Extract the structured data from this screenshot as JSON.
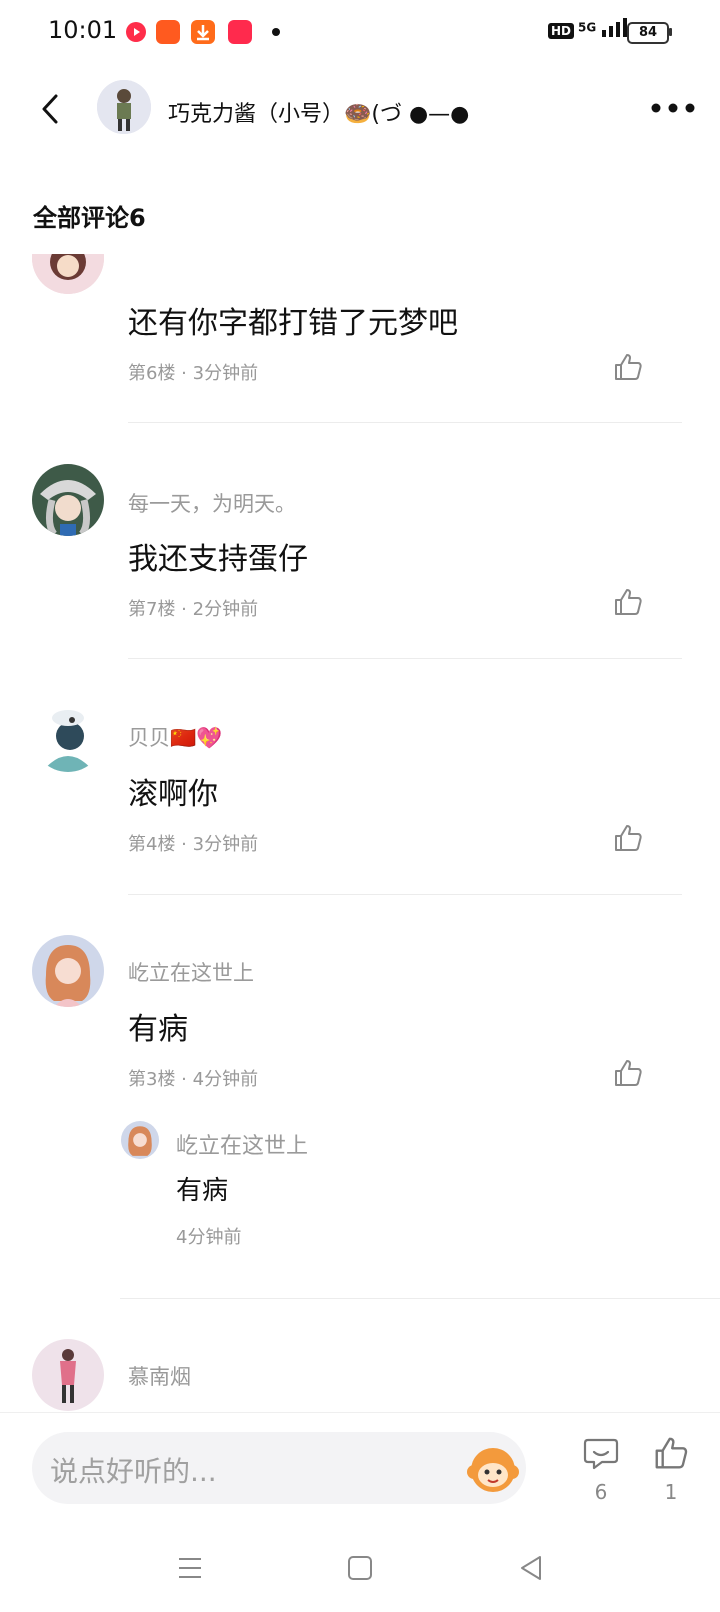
{
  "status_bar": {
    "time": "10:01",
    "network": "HD",
    "signal": "5G",
    "battery": "84"
  },
  "header": {
    "title": "巧克力酱（小号）🍩(づ ●—●"
  },
  "section": {
    "title": "全部评论6"
  },
  "comments": [
    {
      "username": "",
      "text": "还有你字都打错了元梦吧",
      "meta": "第6楼 · 3分钟前"
    },
    {
      "username": "每一天，为明天。",
      "text": "我还支持蛋仔",
      "meta": "第7楼 · 2分钟前"
    },
    {
      "username": "贝贝🇨🇳💖",
      "text": "滚啊你",
      "meta": "第4楼 · 3分钟前"
    },
    {
      "username": "屹立在这世上",
      "text": "有病",
      "meta": "第3楼 · 4分钟前"
    }
  ],
  "reply": {
    "username": "屹立在这世上",
    "text": "有病",
    "time": "4分钟前"
  },
  "last_comment": {
    "username": "慕南烟"
  },
  "bottom_bar": {
    "input_placeholder": "说点好听的...",
    "comment_count": "6",
    "like_count": "1"
  },
  "colors": {
    "text": "#111111",
    "muted": "#9a9a9a",
    "input_bg": "#f3f3f5",
    "accent_icon": "#f39a3c"
  }
}
